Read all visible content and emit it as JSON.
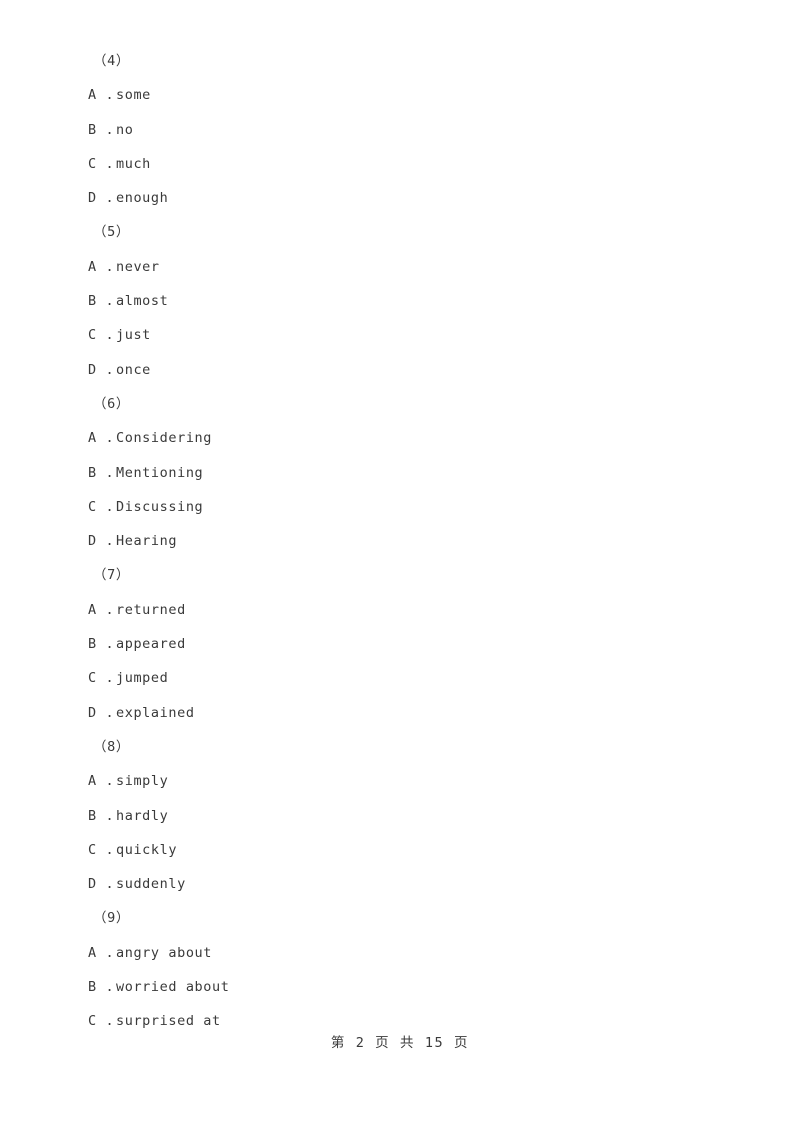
{
  "page": {
    "background_color": "#ffffff",
    "text_color": "#3a3a3a"
  },
  "document": {
    "blocks": [
      {
        "type": "group",
        "label": "（4）"
      },
      {
        "type": "option",
        "letter": "A .",
        "text": "some"
      },
      {
        "type": "option",
        "letter": "B .",
        "text": "no"
      },
      {
        "type": "option",
        "letter": "C .",
        "text": "much"
      },
      {
        "type": "option",
        "letter": "D .",
        "text": "enough"
      },
      {
        "type": "group",
        "label": "（5）"
      },
      {
        "type": "option",
        "letter": "A .",
        "text": "never"
      },
      {
        "type": "option",
        "letter": "B .",
        "text": "almost"
      },
      {
        "type": "option",
        "letter": "C .",
        "text": "just"
      },
      {
        "type": "option",
        "letter": "D .",
        "text": "once"
      },
      {
        "type": "group",
        "label": "（6）"
      },
      {
        "type": "option",
        "letter": "A .",
        "text": "Considering"
      },
      {
        "type": "option",
        "letter": "B .",
        "text": "Mentioning"
      },
      {
        "type": "option",
        "letter": "C .",
        "text": "Discussing"
      },
      {
        "type": "option",
        "letter": "D .",
        "text": "Hearing"
      },
      {
        "type": "group",
        "label": "（7）"
      },
      {
        "type": "option",
        "letter": "A .",
        "text": "returned"
      },
      {
        "type": "option",
        "letter": "B .",
        "text": "appeared"
      },
      {
        "type": "option",
        "letter": "C .",
        "text": "jumped"
      },
      {
        "type": "option",
        "letter": "D .",
        "text": "explained"
      },
      {
        "type": "group",
        "label": "（8）"
      },
      {
        "type": "option",
        "letter": "A .",
        "text": "simply"
      },
      {
        "type": "option",
        "letter": "B .",
        "text": "hardly"
      },
      {
        "type": "option",
        "letter": "C .",
        "text": "quickly"
      },
      {
        "type": "option",
        "letter": "D .",
        "text": "suddenly"
      },
      {
        "type": "group",
        "label": "（9）"
      },
      {
        "type": "option",
        "letter": "A .",
        "text": "angry about"
      },
      {
        "type": "option",
        "letter": "B .",
        "text": "worried about"
      },
      {
        "type": "option",
        "letter": "C .",
        "text": "surprised at"
      }
    ]
  },
  "footer": {
    "text": "第 2 页 共 15 页",
    "current_page": "2",
    "total_pages": "15"
  }
}
